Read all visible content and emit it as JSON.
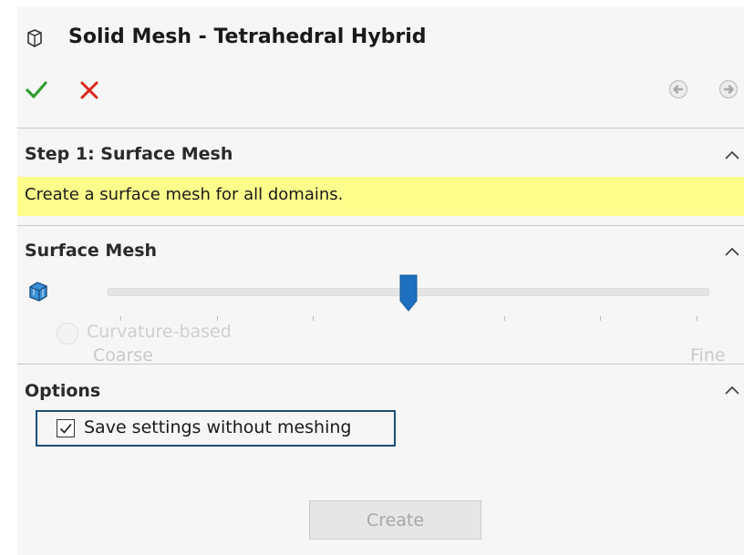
{
  "header": {
    "title": "Solid Mesh - Tetrahedral Hybrid",
    "icons": [
      "solid-part-icon",
      "ok-check-icon",
      "cancel-x-icon",
      "back-arrow-icon",
      "forward-arrow-icon"
    ]
  },
  "step": {
    "title": "Step 1: Surface Mesh",
    "hint": "Create a surface mesh for all domains."
  },
  "surface_mesh": {
    "title": "Surface Mesh",
    "slider_level": 0.5,
    "radio_label": "Curvature-based",
    "min_label": "Coarse",
    "max_label": "Fine"
  },
  "options": {
    "title": "Options",
    "checkbox_label": "Save settings without meshing",
    "checkbox_checked": true
  },
  "create_label": "Create",
  "colors": {
    "accent": "#1e6fbf",
    "hint_background": "#fdfd8c",
    "ok": "#2e9d2e",
    "cancel": "#d9281c",
    "focus_border": "#1c4f7a"
  }
}
